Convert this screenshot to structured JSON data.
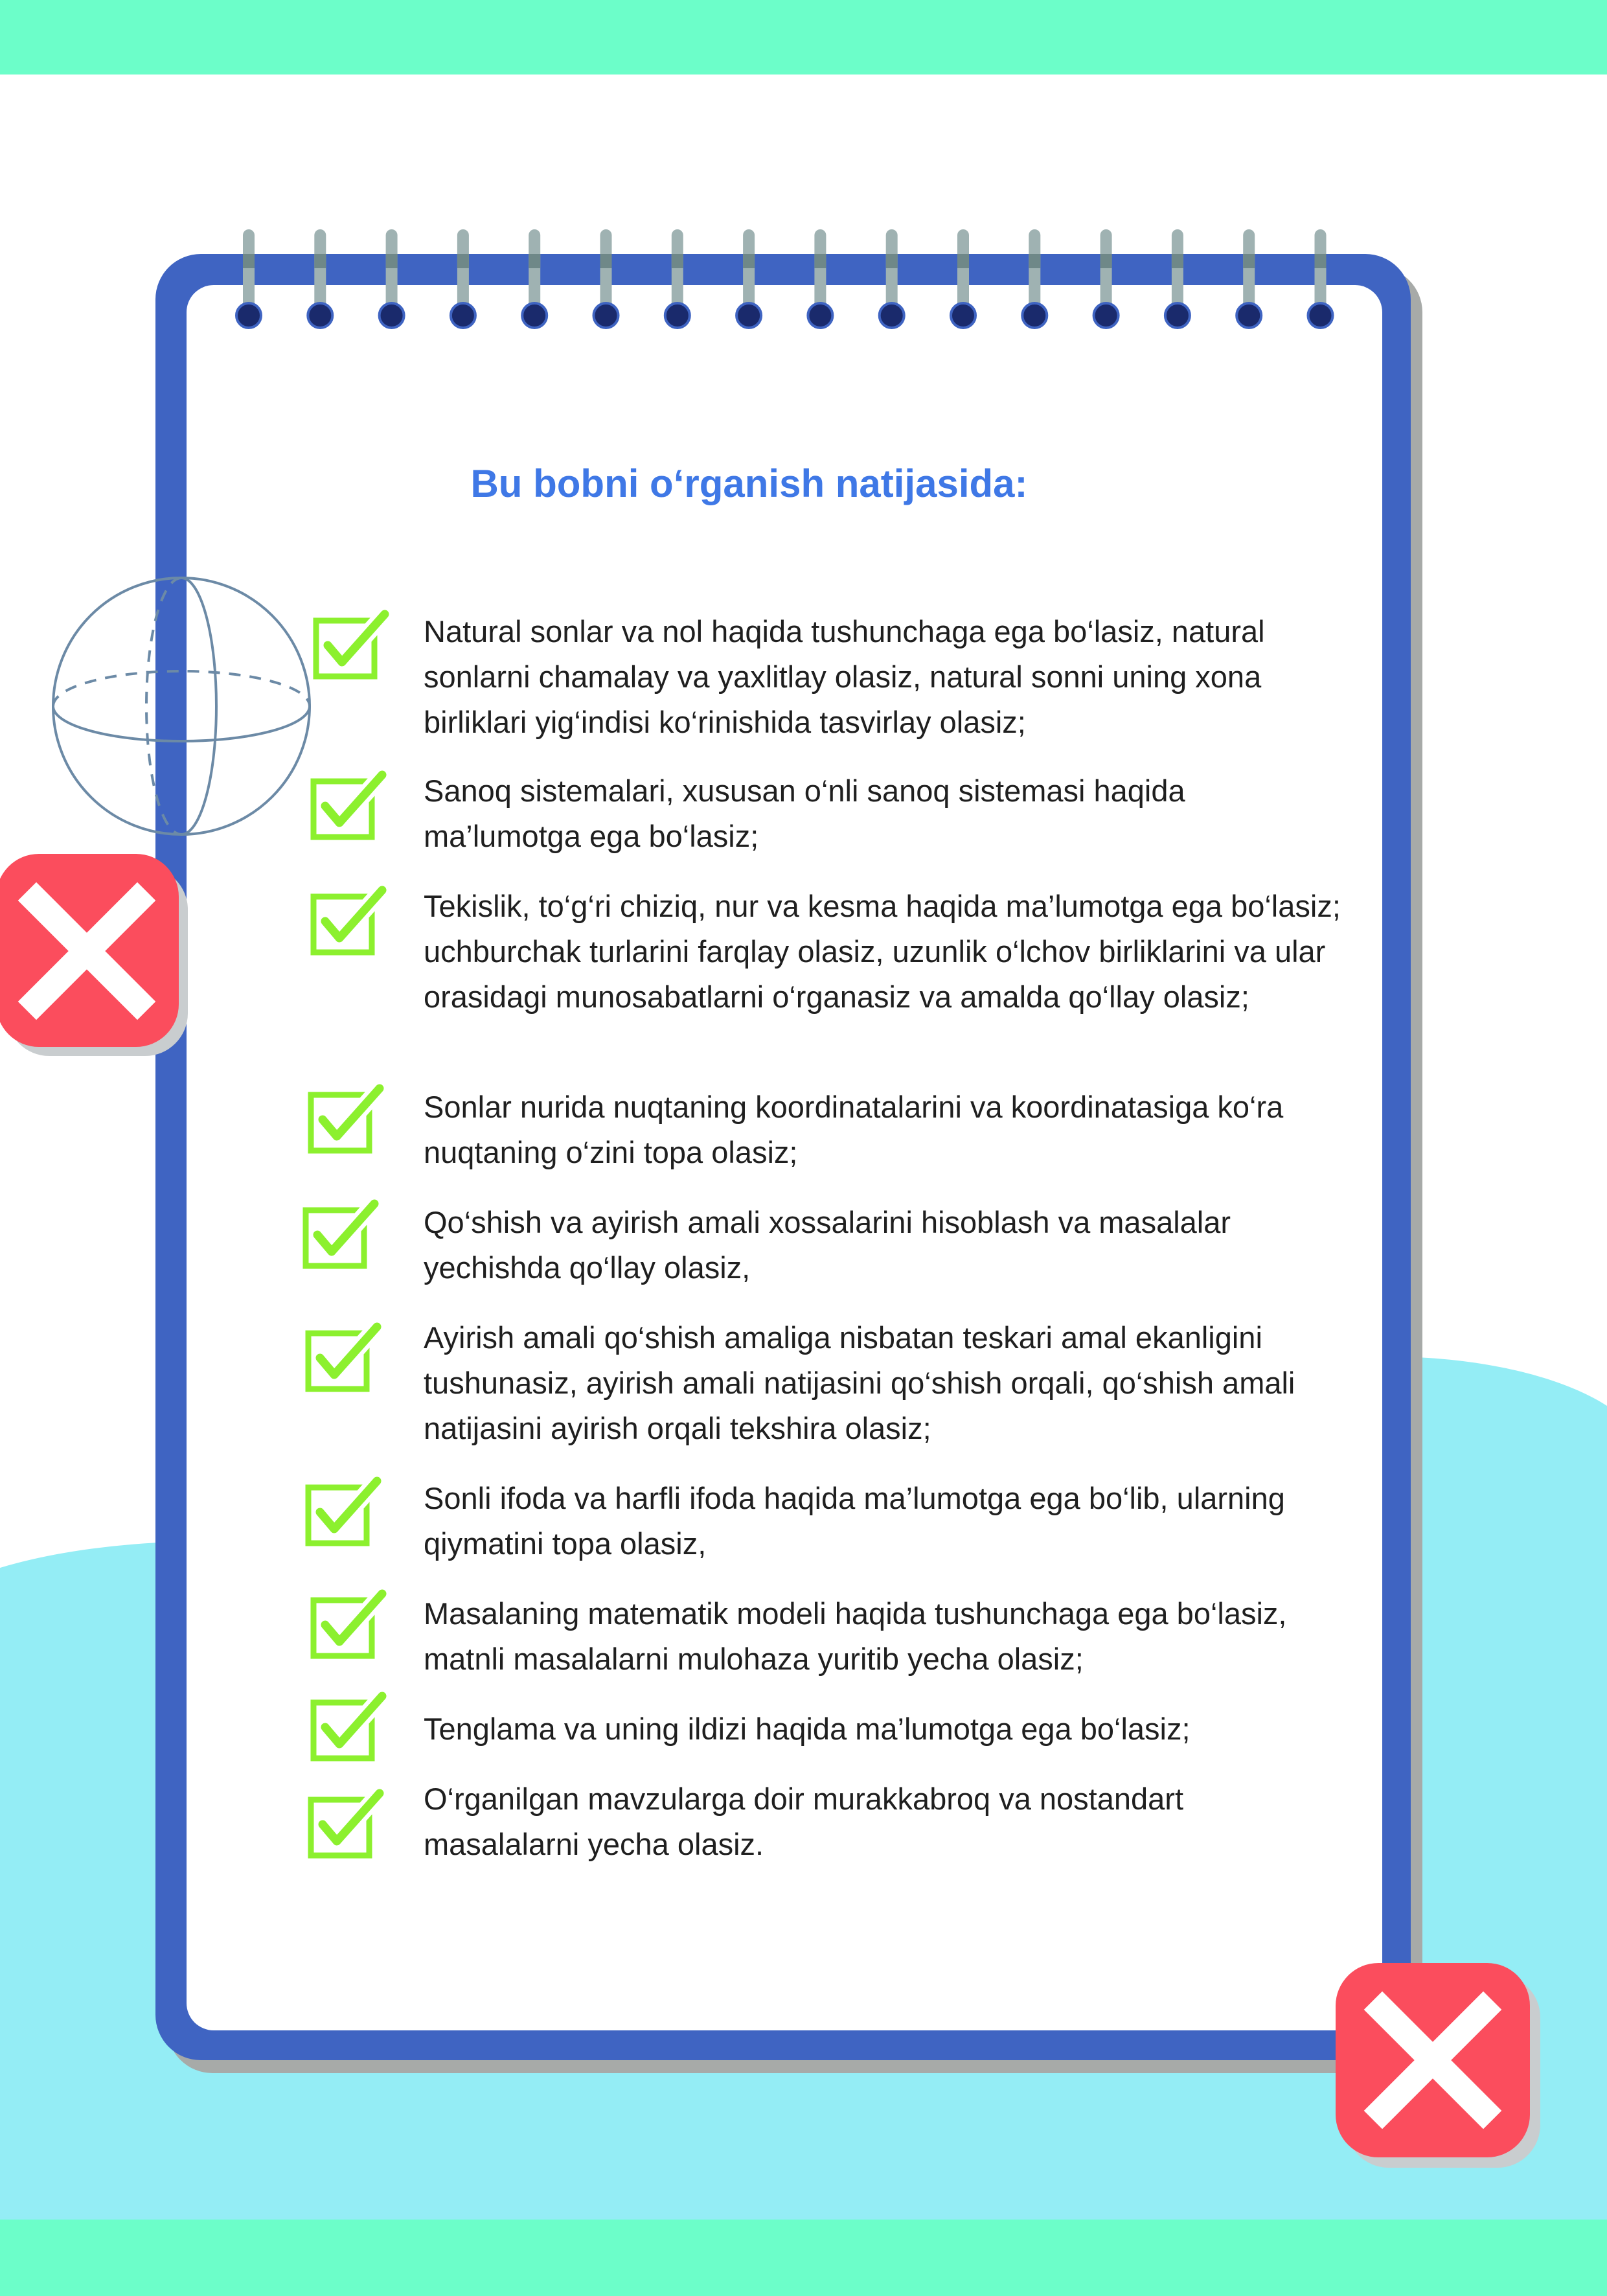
{
  "heading": "Bu bobni o‘rganish natijasida:",
  "outcomes": [
    {
      "text": "Natural sonlar va nol haqida tushunchaga ega bo‘lasiz, natural sonlarni chamalay va yaxlitlay olasiz, natural sonni uning xona birliklari yig‘indisi ko‘rinishida tasvirlay olasiz;"
    },
    {
      "text": "Sanoq sistemalari, xususan o‘nli sanoq sistemasi haqida ma’lumotga ega bo‘lasiz;"
    },
    {
      "text": "Tekislik, to‘g‘ri chiziq, nur va kesma haqida ma’lumotga ega bo‘lasiz; uchburchak turlarini farqlay olasiz, uzunlik o‘lchov birliklarini va ular orasidagi munosabatlarni o‘rganasiz va amalda qo‘llay olasiz;"
    },
    {
      "text": "Sonlar nurida nuqtaning koordinatalarini va koordinatasiga ko‘ra nuqtaning o‘zini topa olasiz;"
    },
    {
      "text": "Qo‘shish va ayirish amali xossalarini hisoblash va masalalar yechishda qo‘llay olasiz,"
    },
    {
      "text": "Ayirish amali qo‘shish amaliga nisbatan teskari amal ekanligini tushunasiz, ayirish amali natijasini qo‘shish orqali, qo‘shish amali natijasini ayirish orqali tekshira olasiz;"
    },
    {
      "text": "Sonli ifoda va harfli ifoda haqida ma’lumotga ega bo‘lib, ularning qiymatini topa olasiz,"
    },
    {
      "text": "Masalaning matematik modeli haqida tushunchaga ega bo‘lasiz, matnli masalalarni mulohaza yuritib yecha olasiz;"
    },
    {
      "text": "Tenglama va uning ildizi haqida ma’lumotga ega bo‘lasiz;"
    },
    {
      "text": "O‘rganilgan mavzularga doir murakkabroq va nostandart masalalarni yecha olasiz."
    }
  ],
  "colors": {
    "band": "#6cfec9",
    "wave": "#94edf5",
    "notebook_frame": "#3f64c2",
    "heading": "#3f78e6",
    "check": "#8cf02e",
    "cross_tile": "#fb4d5d"
  },
  "icons": [
    "check-icon",
    "close-icon",
    "sphere-icon",
    "spiral-ring-icon"
  ]
}
